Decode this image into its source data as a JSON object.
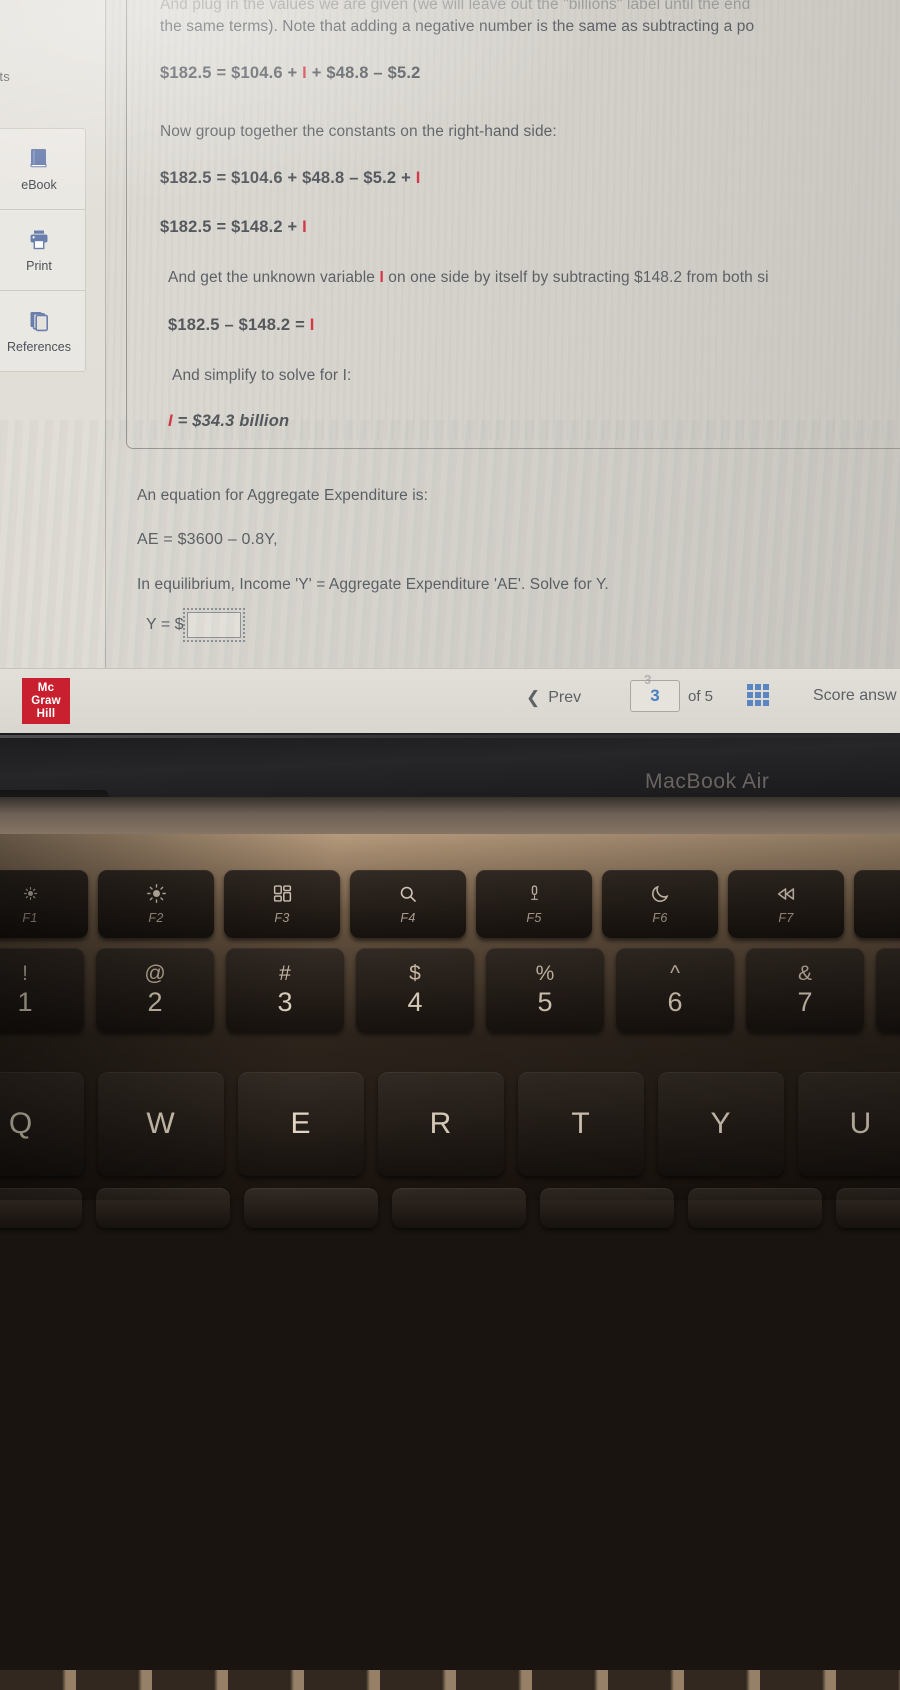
{
  "screen": {
    "sidebar": {
      "truncated_label": "nts",
      "items": [
        {
          "label": "eBook",
          "icon": "book-icon"
        },
        {
          "label": "Print",
          "icon": "printer-icon"
        },
        {
          "label": "References",
          "icon": "copy-pages-icon"
        }
      ]
    },
    "content": {
      "lines": [
        {
          "id": "intro_cut_top",
          "text": "And plug in the values we are given (we will leave out the \"billions\" label until the end",
          "style": "body-faded"
        },
        {
          "id": "intro_cut_2",
          "text": "the same terms). Note that adding a negative number is the same as subtracting a po",
          "style": "body"
        },
        {
          "id": "eq1",
          "text": "$182.5 = $104.6 + I + $48.8 – $5.2",
          "style": "equation",
          "var": "I"
        },
        {
          "id": "step2",
          "text": "Now group together the constants on the right-hand side:",
          "style": "body"
        },
        {
          "id": "eq2",
          "text": "$182.5 = $104.6 + $48.8 – $5.2 + I",
          "style": "equation",
          "var": "I"
        },
        {
          "id": "eq3",
          "text": "$182.5 = $148.2 + I",
          "style": "equation",
          "var": "I"
        },
        {
          "id": "step3",
          "text": "And get the unknown variable I on one side by itself by subtracting $148.2 from both si",
          "style": "body",
          "var": "I"
        },
        {
          "id": "eq4",
          "text": "$182.5 – $148.2 = I",
          "style": "equation",
          "var": "I"
        },
        {
          "id": "step4",
          "text": "And simplify to solve for I:",
          "style": "body"
        },
        {
          "id": "eq5",
          "text": "I = $34.3 billion",
          "style": "equation-italic",
          "var": "I"
        },
        {
          "id": "ae_intro",
          "text": "An equation for Aggregate Expenditure is:",
          "style": "body"
        },
        {
          "id": "ae_eq",
          "text": "AE = $3600 – 0.8Y,",
          "style": "equation-lite"
        },
        {
          "id": "equil",
          "text": "In equilibrium, Income 'Y' = Aggregate Expenditure 'AE'. Solve for Y.",
          "style": "body"
        }
      ],
      "answer": {
        "prefix": "Y = $",
        "value": "",
        "placeholder": ""
      }
    },
    "bottom_nav": {
      "logo_lines": [
        "Mc",
        "Graw",
        "Hill"
      ],
      "logo_color": "#c8202e",
      "prev_label": "Prev",
      "prev_icon": "chevron-left-icon",
      "page_value": "3",
      "page_ghost": "3",
      "of_label": "of  5",
      "grid_icon": "grid-3x3-icon",
      "grid_color": "#4a7fc1",
      "score_label": "Score answ"
    }
  },
  "laptop": {
    "model_label": "MacBook Air",
    "keyboard": {
      "function_row": [
        {
          "key": "F1",
          "icon": "brightness-down-icon"
        },
        {
          "key": "F2",
          "icon": "brightness-up-icon"
        },
        {
          "key": "F3",
          "icon": "mission-control-icon"
        },
        {
          "key": "F4",
          "icon": "spotlight-search-icon"
        },
        {
          "key": "F5",
          "icon": "dictation-mic-icon"
        },
        {
          "key": "F6",
          "icon": "do-not-disturb-moon-icon"
        },
        {
          "key": "F7",
          "icon": "rewind-icon"
        }
      ],
      "number_row": [
        {
          "shift": "!",
          "main": "1"
        },
        {
          "shift": "@",
          "main": "2"
        },
        {
          "shift": "#",
          "main": "3"
        },
        {
          "shift": "$",
          "main": "4"
        },
        {
          "shift": "%",
          "main": "5"
        },
        {
          "shift": "^",
          "main": "6"
        },
        {
          "shift": "&",
          "main": "7"
        }
      ],
      "letter_row": [
        "Q",
        "W",
        "E",
        "R",
        "T",
        "Y",
        "U"
      ]
    }
  }
}
